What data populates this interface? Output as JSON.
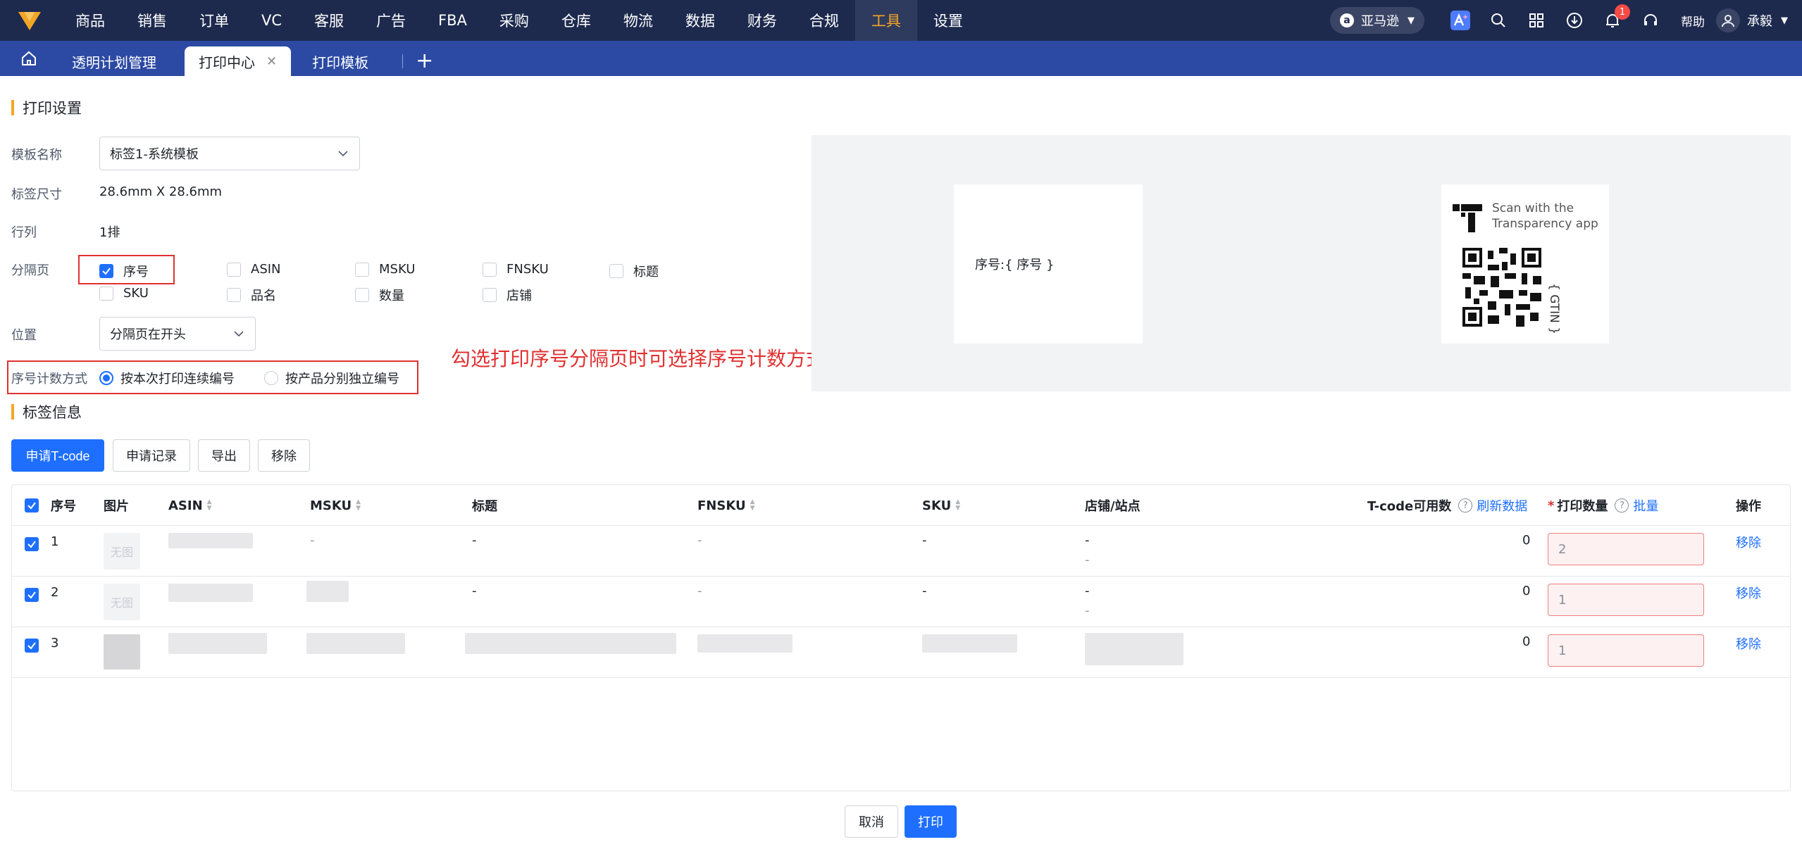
{
  "nav": {
    "items": [
      "商品",
      "销售",
      "订单",
      "VC",
      "客服",
      "广告",
      "FBA",
      "采购",
      "仓库",
      "物流",
      "数据",
      "财务",
      "合规",
      "工具",
      "设置"
    ],
    "active": "工具",
    "store": "亚马逊",
    "notification_count": "1",
    "help": "帮助",
    "user": "承毅"
  },
  "tabs": {
    "items": [
      "透明计划管理",
      "打印中心",
      "打印模板"
    ],
    "active": "打印中心",
    "close": "✕",
    "add": "+"
  },
  "print_settings": {
    "title": "打印设置",
    "template_label": "模板名称",
    "template_value": "标签1-系统模板",
    "size_label": "标签尺寸",
    "size_value": "28.6mm X 28.6mm",
    "rows_label": "行列",
    "rows_value": "1排",
    "separator_label": "分隔页",
    "options": [
      "序号",
      "ASIN",
      "MSKU",
      "FNSKU",
      "标题",
      "SKU",
      "品名",
      "数量",
      "店铺"
    ],
    "checked": [
      "序号"
    ],
    "position_label": "位置",
    "position_value": "分隔页在开头",
    "numbering_label": "序号计数方式",
    "numbering_options": [
      "按本次打印连续编号",
      "按产品分别独立编号"
    ],
    "numbering_selected": "按本次打印连续编号",
    "annotation": "勾选打印序号分隔页时可选择序号计数方式"
  },
  "preview": {
    "separator_text": "序号:{ 序号 }",
    "scan_line1": "Scan with the",
    "scan_line2": "Transparency app",
    "gtin": "{ GTIN }"
  },
  "label_info": {
    "title": "标签信息",
    "buttons": [
      "申请T-code",
      "申请记录",
      "导出",
      "移除"
    ]
  },
  "table": {
    "headers": [
      "序号",
      "图片",
      "ASIN",
      "MSKU",
      "标题",
      "FNSKU",
      "SKU",
      "店铺/站点",
      "T-code可用数",
      "刷新数据",
      "打印数量",
      "批量",
      "操作"
    ],
    "required_mark": "*",
    "no_image": "无图",
    "rows": [
      {
        "index": "1",
        "msku": "-",
        "title": "-",
        "fnsku": "-",
        "sku": "-",
        "store": "-",
        "site": "-",
        "tcode": "0",
        "qty": "2",
        "action": "移除"
      },
      {
        "index": "2",
        "msku": "",
        "title": "-",
        "fnsku": "-",
        "sku": "-",
        "store": "-",
        "site": "-",
        "tcode": "0",
        "qty": "1",
        "action": "移除"
      },
      {
        "index": "3",
        "msku": "",
        "title": "",
        "fnsku": "",
        "sku": "",
        "store": "",
        "site": "",
        "tcode": "0",
        "qty": "1",
        "action": "移除"
      }
    ]
  },
  "footer": {
    "cancel": "取消",
    "print": "打印"
  },
  "colors": {
    "nav_bg": "#1d2a4e",
    "tab_bg": "#2c4aa3",
    "primary": "#1e6fff",
    "accent": "#f5a524",
    "annotation": "#e03131"
  }
}
